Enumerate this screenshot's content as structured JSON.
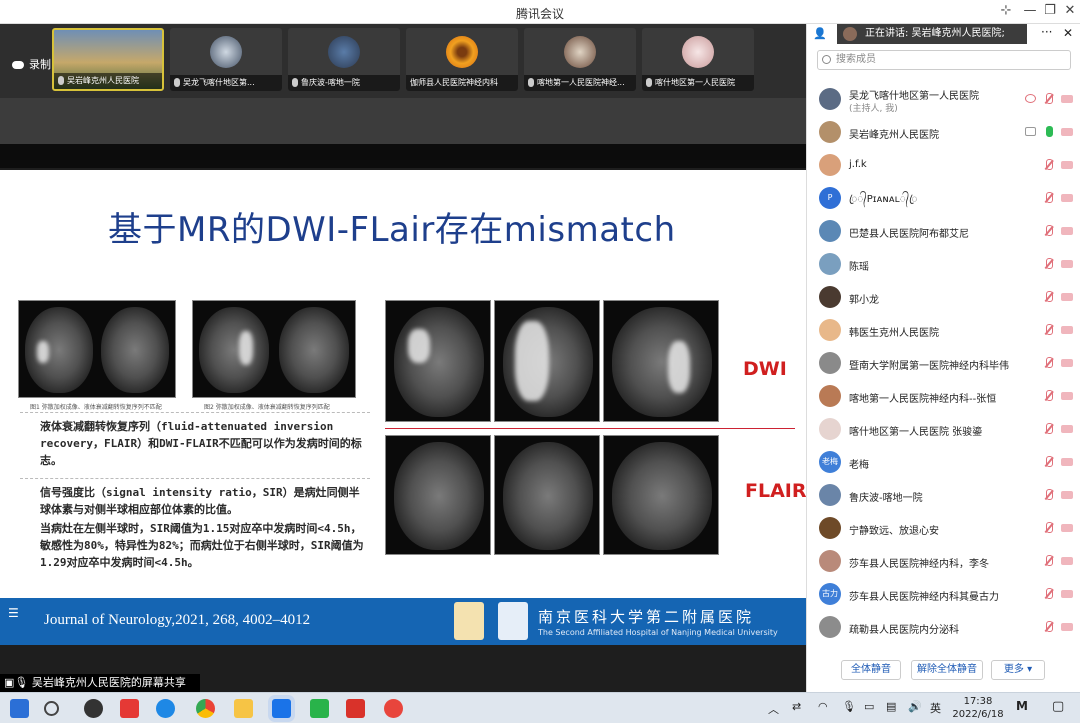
{
  "window": {
    "title": "腾讯会议"
  },
  "recording": {
    "label": "录制中"
  },
  "thumbnails": [
    {
      "name": "吴岩峰克州人民医院"
    },
    {
      "name": "吴龙飞喀什地区第..."
    },
    {
      "name": "鲁庆波-喀地一院"
    },
    {
      "name": "伽师县人民医院神经内科"
    },
    {
      "name": "喀地第一人民医院神经..."
    },
    {
      "name": "喀什地区第一人民医院"
    }
  ],
  "slide": {
    "title": "基于MR的DWI-FLair存在mismatch",
    "caption1": "图1  弥散加权成像、液体衰减翻转恢复序列不匹配",
    "caption2": "图2  弥散加权成像、液体衰减翻转恢复序列匹配",
    "para1": "液体衰减翻转恢复序列（fluid-attenuated inversion recovery，FLAIR）和DWI-FLAIR不匹配可以作为发病时间的标志。",
    "para2": "信号强度比（signal intensity ratio，SIR）是病灶同侧半球体素与对侧半球相应部位体素的比值。",
    "para3": "当病灶在左侧半球时，SIR阈值为1.15对应卒中发病时间<4.5h，敏感性为80%，特异性为82%；而病灶位于右侧半球时，SIR阈值为1.29对应卒中发病时间<4.5h。",
    "label_dwi": "DWI",
    "label_flair": "FLAIR",
    "footer_journal": "Journal of Neurology,2021, 268, 4002–4012",
    "footer_hospital": "南京医科大学第二附属医院",
    "footer_hospital_en": "The Second Affiliated Hospital of Nanjing Medical University"
  },
  "share_banner": "吴岩峰克州人民医院的屏幕共享",
  "panel": {
    "speaking": "正在讲话: 吴岩峰克州人民医院;",
    "search_placeholder": "搜索成员",
    "members": [
      {
        "name": "吴龙飞喀什地区第一人民医院",
        "sub": "(主持人, 我)",
        "mic": "off",
        "avatar": ""
      },
      {
        "name": "吴岩峰克州人民医院",
        "sub": "",
        "mic": "on",
        "avatar": ""
      },
      {
        "name": "j.f.k",
        "sub": "",
        "mic": "off",
        "avatar": ""
      },
      {
        "name": "ꦿ᭄Pɪᴀɴᴀʟ᭄ꦿ",
        "sub": "",
        "mic": "off",
        "avatar": "P"
      },
      {
        "name": "巴楚县人民医院阿布都艾尼",
        "sub": "",
        "mic": "off",
        "avatar": ""
      },
      {
        "name": "陈瑶",
        "sub": "",
        "mic": "off",
        "avatar": ""
      },
      {
        "name": "郭小龙",
        "sub": "",
        "mic": "off",
        "avatar": ""
      },
      {
        "name": "韩医生克州人民医院",
        "sub": "",
        "mic": "off",
        "avatar": ""
      },
      {
        "name": "暨南大学附属第一医院神经内科毕伟",
        "sub": "",
        "mic": "off",
        "avatar": ""
      },
      {
        "name": "喀地第一人民医院神经内科--张恒",
        "sub": "",
        "mic": "off",
        "avatar": ""
      },
      {
        "name": "喀什地区第一人民医院 张骏鎏",
        "sub": "",
        "mic": "off",
        "avatar": ""
      },
      {
        "name": "老梅",
        "sub": "",
        "mic": "off",
        "avatar": "老梅"
      },
      {
        "name": "鲁庆波-喀地一院",
        "sub": "",
        "mic": "off",
        "avatar": ""
      },
      {
        "name": "宁静致远、放退心安",
        "sub": "",
        "mic": "off",
        "avatar": ""
      },
      {
        "name": "莎车县人民医院神经内科，李冬",
        "sub": "",
        "mic": "off",
        "avatar": ""
      },
      {
        "name": "莎车县人民医院神经内科其曼古力",
        "sub": "",
        "mic": "off",
        "avatar": "古力"
      },
      {
        "name": "疏勒县人民医院内分泌科",
        "sub": "",
        "mic": "off",
        "avatar": ""
      }
    ],
    "btn_mute_all": "全体静音",
    "btn_unmute_all": "解除全体静音",
    "btn_more": "更多 ▾"
  },
  "taskbar": {
    "time": "17:38",
    "date": "2022/6/18"
  },
  "colors": {
    "accent": "#1565b3",
    "slide_title": "#1e3f8c",
    "label_red": "#d01f1f"
  }
}
